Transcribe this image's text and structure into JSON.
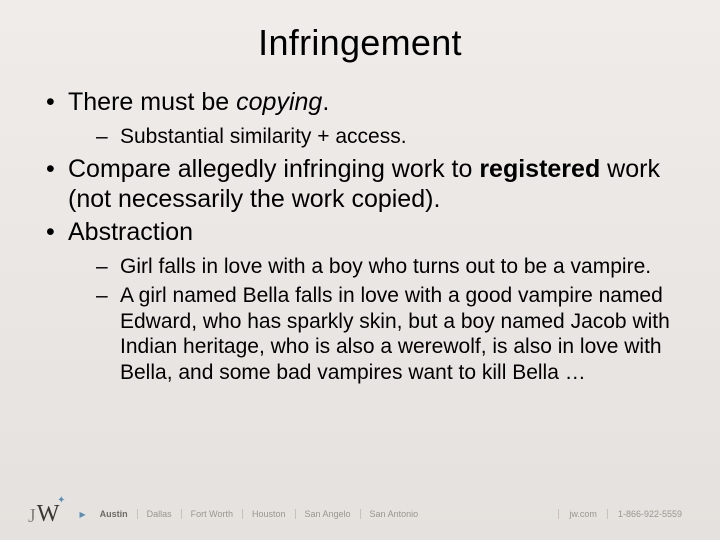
{
  "title": "Infringement",
  "bullets": {
    "b1_pre": "There must be ",
    "b1_em": "copying",
    "b1_post": ".",
    "b1_sub1": "Substantial similarity + access.",
    "b2_pre": "Compare allegedly infringing work to ",
    "b2_strong": "registered",
    "b2_post": " work (not necessarily the work copied).",
    "b3": "Abstraction",
    "b3_sub1": "Girl falls in love with a boy who turns out to be a vampire.",
    "b3_sub2": "A girl named Bella falls in love with a good vampire named Edward, who has sparkly skin, but a boy named Jacob with Indian heritage, who is also a werewolf, is also in love with Bella, and some bad vampires want to kill Bella …"
  },
  "footer": {
    "logo_j": "J",
    "logo_w": "W",
    "cities": [
      "Austin",
      "Dallas",
      "Fort Worth",
      "Houston",
      "San Angelo",
      "San Antonio"
    ],
    "site": "jw.com",
    "phone": "1-866-922-5559"
  }
}
